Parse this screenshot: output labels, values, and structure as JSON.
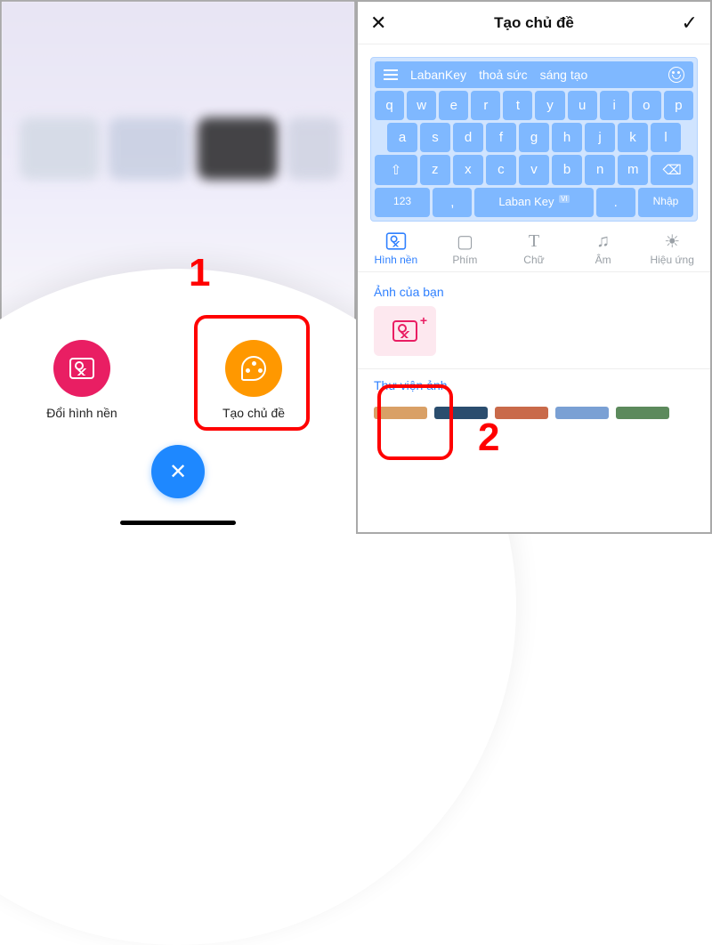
{
  "left": {
    "step_number": "1",
    "change_wallpaper_label": "Đổi hình nền",
    "create_theme_label": "Tạo chủ đề"
  },
  "right": {
    "header_title": "Tạo chủ đề",
    "keyboard_preview": {
      "brand": "LabanKey",
      "word_a": "thoả sức",
      "word_b": "sáng tạo",
      "row1": [
        "q",
        "w",
        "e",
        "r",
        "t",
        "y",
        "u",
        "i",
        "o",
        "p"
      ],
      "row2": [
        "a",
        "s",
        "d",
        "f",
        "g",
        "h",
        "j",
        "k",
        "l"
      ],
      "row3_shift": "⇧",
      "row3": [
        "z",
        "x",
        "c",
        "v",
        "b",
        "n",
        "m"
      ],
      "row3_back": "⌫",
      "num_key": "123",
      "comma_key": ",",
      "space_label": "Laban Key",
      "lang_badge": "VI",
      "period_key": ".",
      "enter_label": "Nhập"
    },
    "tabs": {
      "background": "Hình nền",
      "keys": "Phím",
      "text": "Chữ",
      "sound": "Âm",
      "effect": "Hiệu ứng"
    },
    "section_your_photos": "Ảnh của bạn",
    "section_library": "Thư viện ảnh",
    "step_number": "2"
  }
}
